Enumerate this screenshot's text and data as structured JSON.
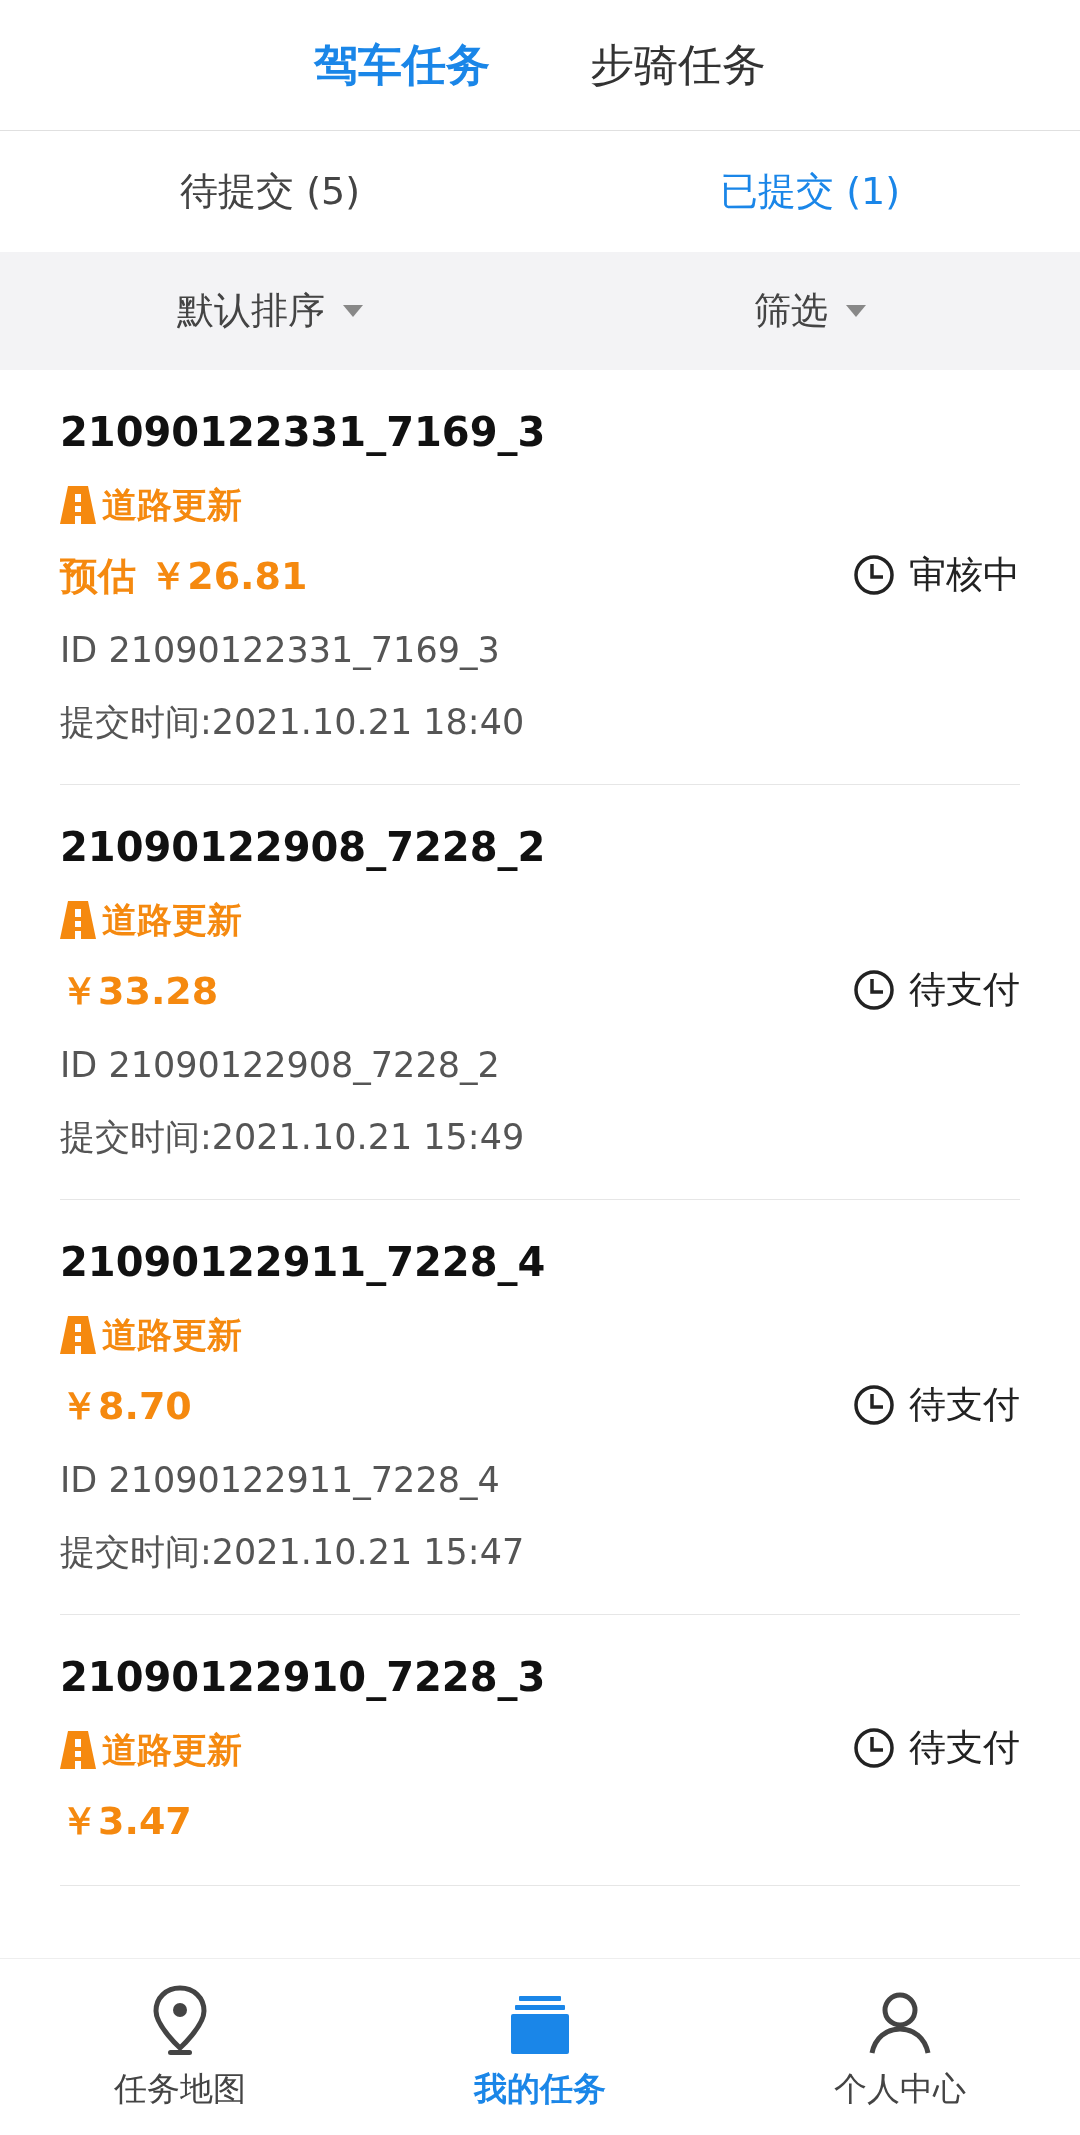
{
  "top_tabs": [
    {
      "label": "驾车任务",
      "selected": true
    },
    {
      "label": "步骑任务",
      "selected": false
    }
  ],
  "sub_tabs": [
    {
      "label": "待提交 (5)",
      "selected": false
    },
    {
      "label": "已提交 (1)",
      "selected": true
    }
  ],
  "filters": [
    {
      "label": "默认排序"
    },
    {
      "label": "筛选"
    }
  ],
  "tasks": [
    {
      "title": "21090122331_7169_3",
      "tag": "道路更新",
      "price": "预估 ￥26.81",
      "id": "ID 21090122331_7169_3",
      "time": "提交时间:2021.10.21 18:40",
      "status": "审核中"
    },
    {
      "title": "21090122908_7228_2",
      "tag": "道路更新",
      "price": "￥33.28",
      "id": "ID 21090122908_7228_2",
      "time": "提交时间:2021.10.21 15:49",
      "status": "待支付"
    },
    {
      "title": "21090122911_7228_4",
      "tag": "道路更新",
      "price": "￥8.70",
      "id": "ID 21090122911_7228_4",
      "time": "提交时间:2021.10.21 15:47",
      "status": "待支付"
    },
    {
      "title": "21090122910_7228_3",
      "tag": "道路更新",
      "price": "￥3.47",
      "status": "待支付"
    }
  ],
  "nav": [
    {
      "kind": "map",
      "label": "任务地图",
      "selected": false
    },
    {
      "kind": "tasks",
      "label": "我的任务",
      "selected": true
    },
    {
      "kind": "profile",
      "label": "个人中心",
      "selected": false
    }
  ]
}
